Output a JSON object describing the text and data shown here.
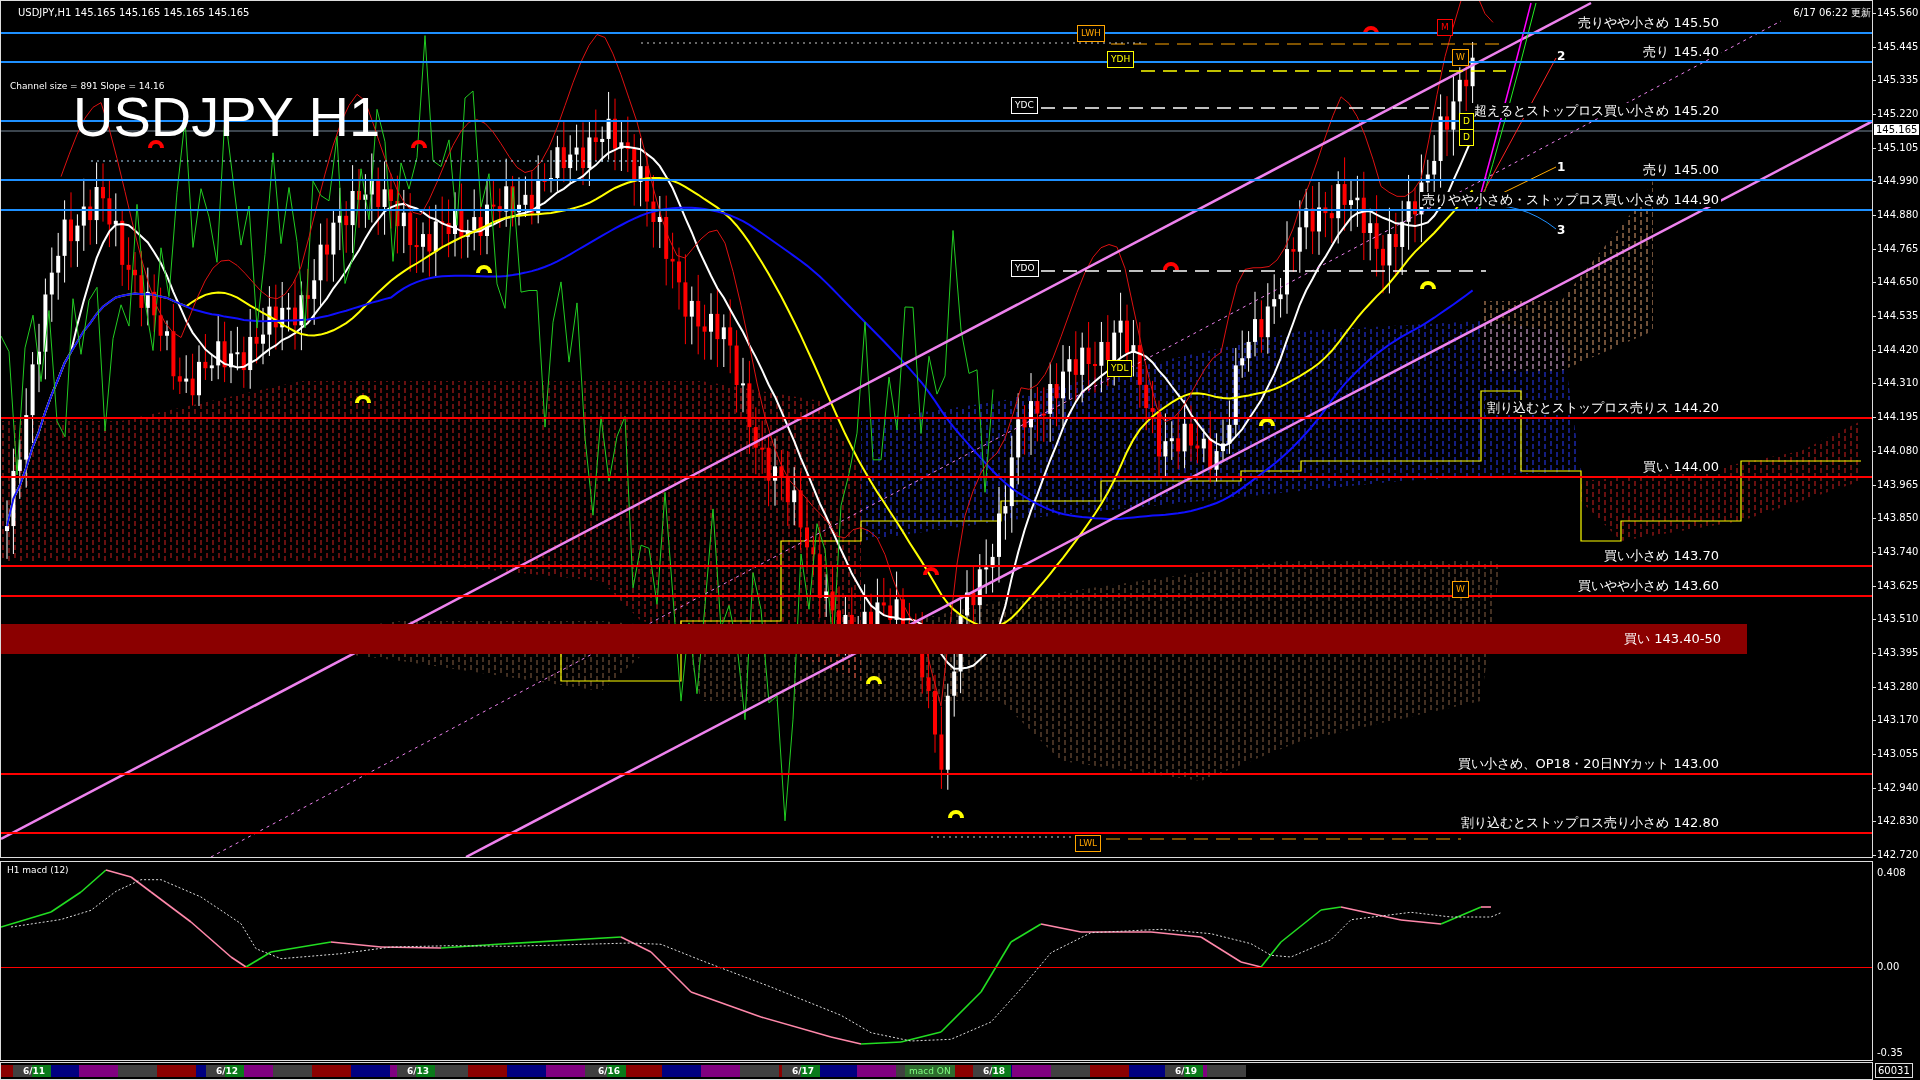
{
  "header": {
    "symbol_info": "USDJPY,H1  145.165 145.165 145.165 145.165",
    "channel_info": "Channel size = 891 Slope = 14.16",
    "title": "USDJPY H1",
    "updated": "6/17 06:22 更新"
  },
  "price_panel": {
    "axis_ticks": [
      "145.560",
      "145.445",
      "145.335",
      "145.220",
      "145.105",
      "144.990",
      "144.880",
      "144.765",
      "144.650",
      "144.535",
      "144.420",
      "144.310",
      "144.195",
      "144.080",
      "143.965",
      "143.850",
      "143.740",
      "143.625",
      "143.510",
      "143.395",
      "143.280",
      "143.170",
      "143.055",
      "142.940",
      "142.830",
      "142.720"
    ],
    "current_price": "145.165",
    "levels": [
      {
        "label": "売りやや小さめ 145.50",
        "color": "#1e90ff"
      },
      {
        "label": "売り 145.40",
        "color": "#1e90ff"
      },
      {
        "label": "超えるとストップロス買い小さめ 145.20",
        "color": "#1e90ff"
      },
      {
        "label": "売り 145.00",
        "color": "#1e90ff"
      },
      {
        "label": "売りやや小さめ・ストップロス買い小さめ 144.90",
        "color": "#1e90ff"
      },
      {
        "label": "割り込むとストップロス売りス 144.20",
        "color": "#ff0000"
      },
      {
        "label": "買い 144.00",
        "color": "#ff0000"
      },
      {
        "label": "買い小さめ 143.70",
        "color": "#ff0000"
      },
      {
        "label": "買いやや小さめ 143.60",
        "color": "#ff0000"
      },
      {
        "label": "買い小さめ、OP18・20日NYカット 143.00",
        "color": "#ff0000"
      },
      {
        "label": "割り込むとストップロス売り小さめ 142.80",
        "color": "#ff0000"
      }
    ],
    "zone": {
      "label": "買い 143.40-50"
    },
    "markers": [
      {
        "label": "LWH",
        "color": "#ffa500"
      },
      {
        "label": "YDH",
        "color": "#ffff00"
      },
      {
        "label": "YDC",
        "color": "#ffffff"
      },
      {
        "label": "YDO",
        "color": "#ffffff"
      },
      {
        "label": "YDL",
        "color": "#ffff00"
      },
      {
        "label": "LWL",
        "color": "#ffa500"
      },
      {
        "label": "M",
        "color": "#ff0000"
      },
      {
        "label": "W",
        "color": "#ffa500"
      },
      {
        "label": "D",
        "color": "#ffff00"
      },
      {
        "label": "D",
        "color": "#ffff00"
      },
      {
        "label": "W",
        "color": "#ffa500"
      }
    ],
    "channel_labels": [
      "2",
      "1",
      "3"
    ]
  },
  "macd_panel": {
    "title": "H1 macd (12)",
    "axis_ticks": [
      "0.408",
      "0.00",
      "-0.35"
    ],
    "volume": "60031"
  },
  "date_bar": {
    "dates": [
      "6/11",
      "6/12",
      "6/13",
      "6/16",
      "6/17",
      "6/18",
      "6/19"
    ],
    "indicator": "macd ON"
  }
}
